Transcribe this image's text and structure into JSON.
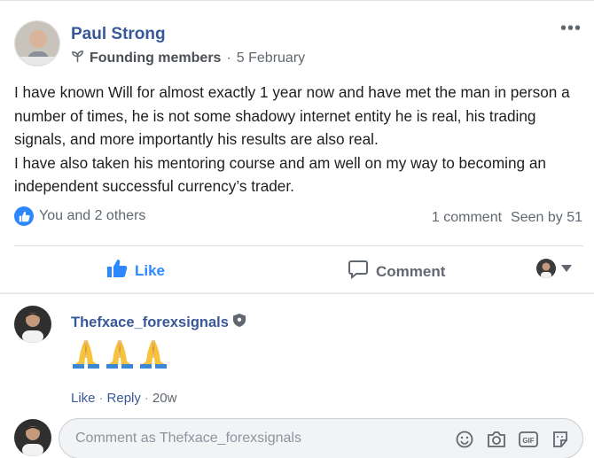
{
  "post": {
    "author": "Paul Strong",
    "group_label": "Founding members",
    "date": "5 February",
    "more_label": "•••",
    "paragraphs": [
      "I have known Will for almost exactly 1 year now and have met the man in person a number of times, he is not some shadowy internet entity he is real, his trading signals, and more importantly his results are also real.",
      "I have also taken his mentoring course and am well on my way to becoming an independent successful currency’s trader."
    ],
    "reactions_text": "You and 2 others",
    "comment_count": "1 comment",
    "seen_by": "Seen by 51"
  },
  "actions": {
    "like_label": "Like",
    "comment_label": "Comment"
  },
  "comment": {
    "author": "Thefxace_forexsignals",
    "emoji_text": "🙏🙏🙏",
    "like_label": "Like",
    "reply_label": "Reply",
    "age": "20w"
  },
  "composer": {
    "placeholder": "Comment as Thefxace_forexsignals"
  },
  "colors": {
    "link_blue": "#385898",
    "like_blue": "#2d88ff",
    "muted": "#606770"
  }
}
